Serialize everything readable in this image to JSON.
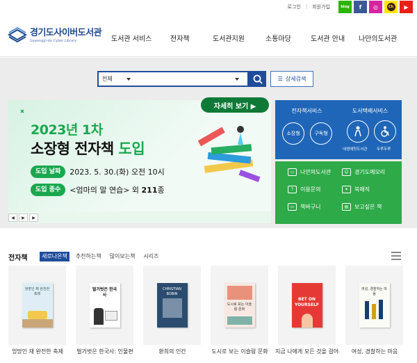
{
  "top": {
    "login": "로그인",
    "join": "회원가입",
    "social": [
      {
        "name": "blog-icon",
        "label": "blog"
      },
      {
        "name": "facebook-icon",
        "label": "f"
      },
      {
        "name": "instagram-icon",
        "label": "◎"
      },
      {
        "name": "kakao-channel-icon",
        "label": "Ch"
      },
      {
        "name": "youtube-icon",
        "label": "▶"
      }
    ]
  },
  "header": {
    "logo_title": "경기도사이버도서관",
    "logo_sub": "Gyeonggi-do Cyber Library",
    "nav": [
      "도서관 서비스",
      "전자책",
      "도서관지원",
      "소통마당",
      "도서관 안내",
      "나만의도서관"
    ]
  },
  "search": {
    "scope": "전체",
    "advanced": "상세검색"
  },
  "banner": {
    "line1": "2023년 1차",
    "line2_a": "소장형 전자책 ",
    "line2_b": "도입",
    "date_tag": "도입 날짜",
    "date_val": "2023. 5. 30.(화) 오전 10시",
    "kind_tag": "도입 종수",
    "kind_val_a": "<엄마의 말 연습> 외 ",
    "kind_val_b": "211",
    "kind_val_c": "종",
    "more": "자세히 보기 ▶"
  },
  "services": {
    "ebook_title": "전자책서비스",
    "ebook_items": [
      "소장형",
      "구독형"
    ],
    "delivery_title": "도서택배서비스",
    "delivery_small": [
      "내생애첫도서관",
      "두루두루"
    ],
    "green": [
      "나만의도서관",
      "경기도메모리",
      "이용문의",
      "북매직",
      "책바구니",
      "보고싶은 책"
    ]
  },
  "ebooks": {
    "title": "전자책",
    "tabs": [
      "새로나온책",
      "추천하는책",
      "많이보는책",
      "시리즈"
    ],
    "items": [
      {
        "title": "엉망인 채 완전한 축제",
        "cover": "엉망인 채 완전한 축제"
      },
      {
        "title": "벌거벗은 한국사: 인물편",
        "cover": "벌거벗은 한국사"
      },
      {
        "title": "환희의 인간",
        "cover": "CHRISTIAN BOBIN"
      },
      {
        "title": "도시로 보는 이슬람 문화",
        "cover": "도시로 보는 이슬람 문화"
      },
      {
        "title": "지금 나에게 모든 것을 걸어라",
        "cover": "BET ON YOURSELF"
      },
      {
        "title": "여성, 경찰하는 마음",
        "cover": "여성, 경찰하는 마음"
      }
    ]
  }
}
